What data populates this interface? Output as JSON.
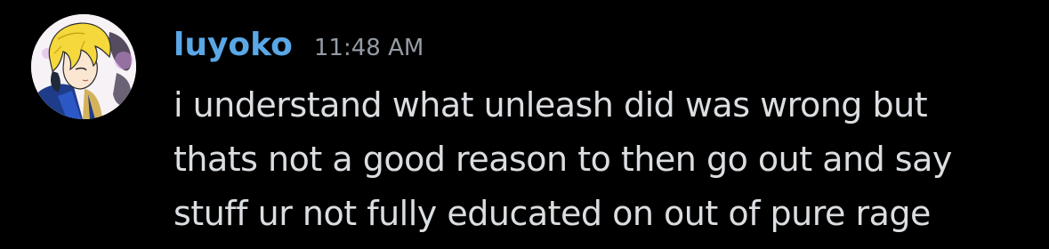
{
  "message": {
    "author": "luyoko",
    "timestamp": "11:48 AM",
    "lines": [
      "i understand what unleash did was wrong but",
      "thats not a good reason to then go out and say",
      "stuff ur not fully educated on out of pure rage"
    ]
  },
  "colors": {
    "background": "#000000",
    "author": "#5aa7e6",
    "timestamp": "#949ba4",
    "text": "#dbdee1"
  },
  "avatar": {
    "icon": "user-avatar-icon"
  }
}
